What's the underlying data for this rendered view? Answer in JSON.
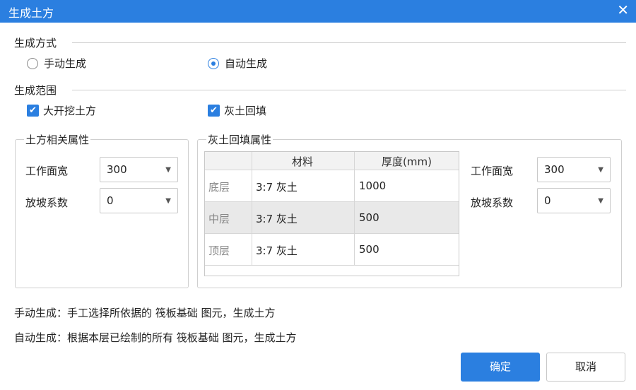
{
  "window": {
    "title": "生成土方"
  },
  "mode": {
    "label": "生成方式",
    "options": [
      {
        "label": "手动生成",
        "checked": false
      },
      {
        "label": "自动生成",
        "checked": true
      }
    ]
  },
  "range": {
    "label": "生成范围",
    "options": [
      {
        "label": "大开挖土方",
        "checked": true
      },
      {
        "label": "灰土回填",
        "checked": true
      }
    ]
  },
  "earth_props": {
    "title": "土方相关属性",
    "work_width_label": "工作面宽",
    "work_width_value": "300",
    "slope_label": "放坡系数",
    "slope_value": "0"
  },
  "backfill_props": {
    "title": "灰土回填属性",
    "columns": [
      "材料",
      "厚度(mm)"
    ],
    "rows": [
      {
        "layer": "底层",
        "material": "3:7 灰土",
        "thickness": "1000"
      },
      {
        "layer": "中层",
        "material": "3:7 灰土",
        "thickness": "500"
      },
      {
        "layer": "顶层",
        "material": "3:7 灰土",
        "thickness": "500"
      }
    ],
    "work_width_label": "工作面宽",
    "work_width_value": "300",
    "slope_label": "放坡系数",
    "slope_value": "0"
  },
  "notes": [
    "手动生成：手工选择所依据的 筏板基础 图元，生成土方",
    "自动生成：根据本层已绘制的所有 筏板基础 图元，生成土方"
  ],
  "buttons": {
    "ok": "确定",
    "cancel": "取消"
  }
}
